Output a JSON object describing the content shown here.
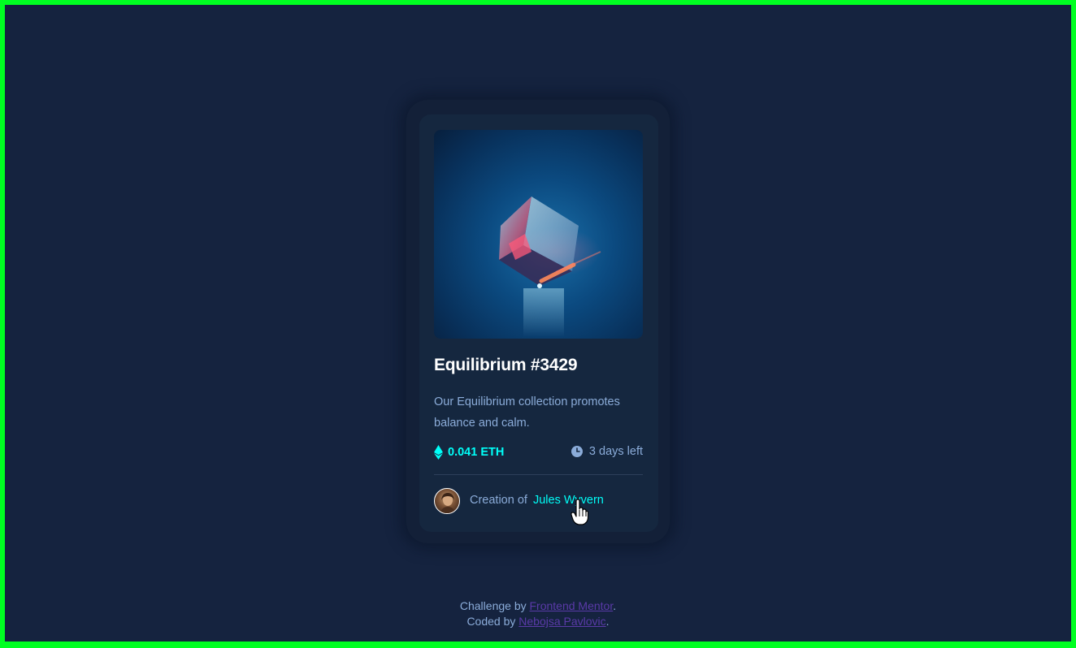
{
  "card": {
    "image_alt": "equilibrium",
    "title": "Equilibrium #3429",
    "description": "Our Equilibrium collection promotes balance and calm.",
    "price": "0.041 ETH",
    "time_left": "3 days left",
    "creation_prefix": "Creation of",
    "creator_name": "Jules Wyvern",
    "icons": {
      "price": "ethereum-icon",
      "time": "clock-icon",
      "cursor": "hand-pointer-cursor"
    }
  },
  "footer": {
    "line1_prefix": "Challenge by",
    "line1_link": "Frontend Mentor",
    "line1_suffix": ".",
    "line2_prefix": "Coded by",
    "line2_link": "Nebojsa Pavlovic",
    "line2_suffix": "."
  },
  "colors": {
    "background": "#15233f",
    "card": "#15273f",
    "accent_cyan": "#00fff8",
    "soft_blue": "#8bacd9",
    "frame": "#00ff22",
    "link_violet": "#5a3aa8"
  }
}
